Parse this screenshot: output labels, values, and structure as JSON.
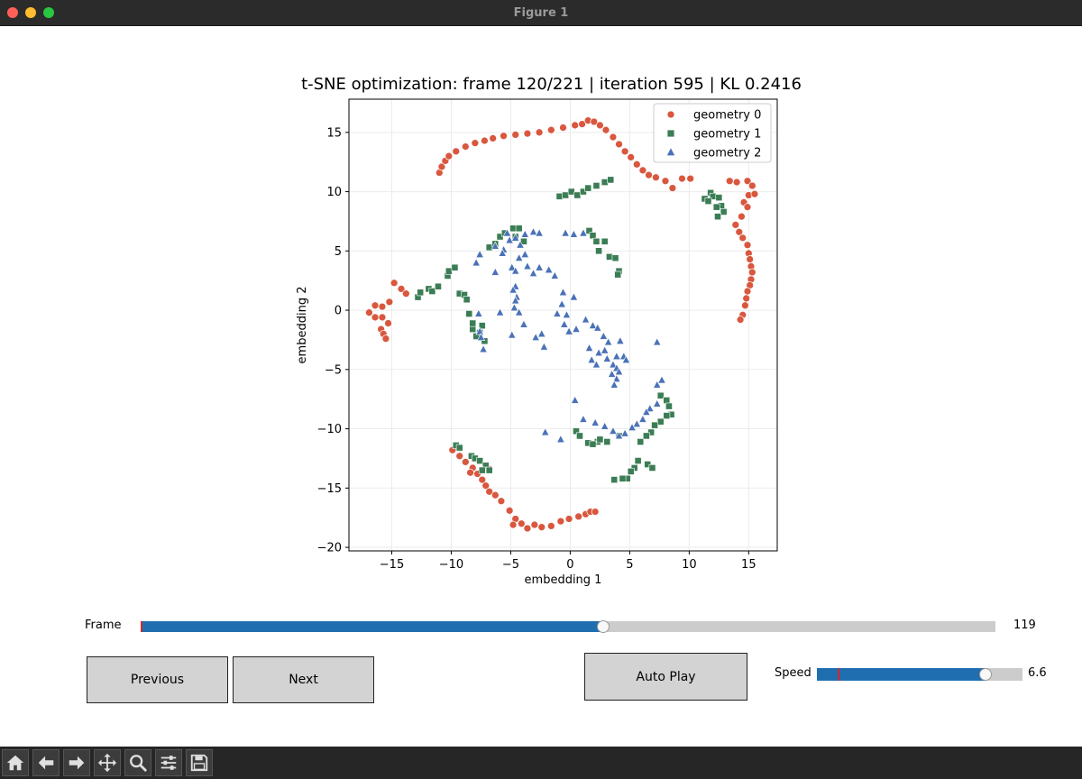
{
  "window": {
    "title": "Figure 1"
  },
  "chart_data": {
    "type": "scatter",
    "title": "t-SNE optimization: frame 120/221 | iteration 595 | KL 0.2416",
    "xlabel": "embedding 1",
    "ylabel": "embedding 2",
    "xlim": [
      -18.6,
      17.4
    ],
    "ylim": [
      -20.3,
      17.8
    ],
    "xticks": [
      -15,
      -10,
      -5,
      0,
      5,
      10,
      15
    ],
    "yticks": [
      -20,
      -15,
      -10,
      -5,
      0,
      5,
      10,
      15
    ],
    "xtick_labels": [
      "−15",
      "−10",
      "−5",
      "0",
      "5",
      "10",
      "15"
    ],
    "ytick_labels": [
      "−20",
      "−15",
      "−10",
      "−5",
      "0",
      "5",
      "10",
      "15"
    ],
    "grid": true,
    "legend_position": "upper right",
    "series": [
      {
        "name": "geometry 0",
        "marker": "circle",
        "color": "#d9573e",
        "points": [
          [
            -11,
            11.6
          ],
          [
            -10.8,
            12.1
          ],
          [
            -10.5,
            12.6
          ],
          [
            -10.2,
            13
          ],
          [
            -9.6,
            13.4
          ],
          [
            -8.8,
            13.8
          ],
          [
            -8,
            14.1
          ],
          [
            -7.2,
            14.3
          ],
          [
            -6.5,
            14.5
          ],
          [
            -5.6,
            14.7
          ],
          [
            -4.6,
            14.8
          ],
          [
            -3.6,
            14.9
          ],
          [
            -2.6,
            15
          ],
          [
            -1.6,
            15.2
          ],
          [
            -0.6,
            15.4
          ],
          [
            0.4,
            15.6
          ],
          [
            1,
            15.7
          ],
          [
            1.5,
            16
          ],
          [
            2,
            15.9
          ],
          [
            2.5,
            15.6
          ],
          [
            3,
            15.2
          ],
          [
            3.6,
            14.6
          ],
          [
            4.1,
            14
          ],
          [
            4.6,
            13.4
          ],
          [
            5.1,
            12.9
          ],
          [
            5.6,
            12.3
          ],
          [
            6.1,
            11.8
          ],
          [
            6.6,
            11.4
          ],
          [
            7.2,
            11.2
          ],
          [
            8,
            10.9
          ],
          [
            8.6,
            10.3
          ],
          [
            9.4,
            11.1
          ],
          [
            10.1,
            11.1
          ],
          [
            13.4,
            10.9
          ],
          [
            14,
            10.8
          ],
          [
            14.9,
            10.9
          ],
          [
            15.3,
            10.5
          ],
          [
            15,
            9.7
          ],
          [
            15.5,
            9.8
          ],
          [
            14.6,
            9.1
          ],
          [
            14.9,
            8.7
          ],
          [
            14.4,
            7.9
          ],
          [
            13.9,
            7.2
          ],
          [
            14.2,
            6.6
          ],
          [
            14.5,
            6.1
          ],
          [
            14.9,
            5.5
          ],
          [
            15,
            4.8
          ],
          [
            15.1,
            4.3
          ],
          [
            15.2,
            3.7
          ],
          [
            15.3,
            3.2
          ],
          [
            15.2,
            2.6
          ],
          [
            15.1,
            2.1
          ],
          [
            14.9,
            1.6
          ],
          [
            14.8,
            1
          ],
          [
            14.7,
            0.4
          ],
          [
            14.5,
            -0.4
          ],
          [
            14.3,
            -0.8
          ],
          [
            -14.8,
            2.3
          ],
          [
            -14.2,
            1.8
          ],
          [
            -13.8,
            1.4
          ],
          [
            -15.2,
            0.7
          ],
          [
            -15.8,
            0.3
          ],
          [
            -16.4,
            0.4
          ],
          [
            -16.9,
            -0.2
          ],
          [
            -16.4,
            -0.6
          ],
          [
            -15.8,
            -0.6
          ],
          [
            -15.3,
            -1.1
          ],
          [
            -15.9,
            -1.6
          ],
          [
            -15.7,
            -2
          ],
          [
            -15.5,
            -2.4
          ],
          [
            -9.9,
            -11.8
          ],
          [
            -9.3,
            -12.3
          ],
          [
            -8.8,
            -12.8
          ],
          [
            -8.2,
            -13.3
          ],
          [
            -7.8,
            -13.8
          ],
          [
            -7.4,
            -14.3
          ],
          [
            -7.1,
            -14.8
          ],
          [
            -6.8,
            -15.3
          ],
          [
            -6.3,
            -15.6
          ],
          [
            -5.8,
            -16.1
          ],
          [
            -5.1,
            -16.9
          ],
          [
            -4.6,
            -17.6
          ],
          [
            -4.1,
            -18
          ],
          [
            -3.6,
            -18.4
          ],
          [
            -3,
            -18.1
          ],
          [
            -2.4,
            -18.3
          ],
          [
            -1.6,
            -18.2
          ],
          [
            -0.8,
            -17.8
          ],
          [
            -0.1,
            -17.6
          ],
          [
            0.7,
            -17.4
          ],
          [
            1.3,
            -17.2
          ],
          [
            1.7,
            -17
          ],
          [
            2.1,
            -17
          ],
          [
            -4.8,
            -18.1
          ],
          [
            -6.8,
            -13.4
          ],
          [
            -8.4,
            -13.7
          ]
        ]
      },
      {
        "name": "geometry 1",
        "marker": "square",
        "color": "#3b7d55",
        "points": [
          [
            -12.8,
            1.1
          ],
          [
            -12.6,
            1.5
          ],
          [
            -11.9,
            1.8
          ],
          [
            -11.6,
            1.6
          ],
          [
            -11.1,
            2
          ],
          [
            -10.3,
            2.9
          ],
          [
            -10.2,
            3.3
          ],
          [
            -9.7,
            3.6
          ],
          [
            -9.3,
            1.4
          ],
          [
            -8.9,
            1.3
          ],
          [
            -8.7,
            0.9
          ],
          [
            -8.5,
            -0.3
          ],
          [
            -8.2,
            -1.6
          ],
          [
            -7.6,
            -1.9
          ],
          [
            -7.4,
            -1.3
          ],
          [
            -7.9,
            -2.2
          ],
          [
            -7.2,
            -2.6
          ],
          [
            -6.8,
            5.3
          ],
          [
            -6.3,
            5.6
          ],
          [
            -5.9,
            6.2
          ],
          [
            -5.5,
            6.5
          ],
          [
            -4.8,
            6.9
          ],
          [
            -4.3,
            6.9
          ],
          [
            -4.6,
            6.2
          ],
          [
            -3.9,
            5.8
          ],
          [
            -0.9,
            9.6
          ],
          [
            -0.4,
            9.7
          ],
          [
            0.1,
            10
          ],
          [
            0.6,
            9.7
          ],
          [
            1.1,
            10
          ],
          [
            1.5,
            10.3
          ],
          [
            2.2,
            10.5
          ],
          [
            2.9,
            10.8
          ],
          [
            3.4,
            11
          ],
          [
            1.6,
            6.7
          ],
          [
            1.9,
            6.3
          ],
          [
            2.2,
            5.8
          ],
          [
            2.9,
            5.8
          ],
          [
            2.4,
            5
          ],
          [
            3.3,
            4.5
          ],
          [
            3.8,
            4.4
          ],
          [
            4.1,
            3.3
          ],
          [
            4,
            3
          ],
          [
            11.8,
            9.9
          ],
          [
            12,
            9.6
          ],
          [
            11.3,
            9.4
          ],
          [
            11.6,
            9.2
          ],
          [
            12.5,
            9.5
          ],
          [
            12.7,
            8.8
          ],
          [
            12.9,
            8.3
          ],
          [
            12.4,
            7.9
          ],
          [
            12.3,
            8.7
          ],
          [
            7.6,
            -7.2
          ],
          [
            8.1,
            -7.6
          ],
          [
            8.3,
            -8.1
          ],
          [
            8.5,
            -8.8
          ],
          [
            8.1,
            -8.9
          ],
          [
            7.6,
            -9.4
          ],
          [
            7.1,
            -9.7
          ],
          [
            6.8,
            -10.3
          ],
          [
            6.4,
            -10.6
          ],
          [
            5.9,
            -11.1
          ],
          [
            5.7,
            -12.7
          ],
          [
            6.5,
            -13
          ],
          [
            6.9,
            -13.3
          ],
          [
            5.4,
            -13.3
          ],
          [
            5.1,
            -13.6
          ],
          [
            4.8,
            -14.2
          ],
          [
            4.4,
            -14.2
          ],
          [
            3.7,
            -14.3
          ],
          [
            -9.6,
            -11.4
          ],
          [
            -9.3,
            -11.6
          ],
          [
            -8.3,
            -12.3
          ],
          [
            -8,
            -12.5
          ],
          [
            -7.6,
            -12.7
          ],
          [
            -7.1,
            -13.1
          ],
          [
            -7.4,
            -13.5
          ],
          [
            -6.8,
            -13.5
          ],
          [
            0.5,
            -10.2
          ],
          [
            0.8,
            -10.6
          ],
          [
            1.5,
            -11.2
          ],
          [
            2.3,
            -11.1
          ],
          [
            1.9,
            -11.3
          ],
          [
            2.5,
            -10.9
          ],
          [
            3.1,
            -11.1
          ],
          [
            4.1,
            -10.6
          ],
          [
            -8.2,
            -1.1
          ]
        ]
      },
      {
        "name": "geometry 2",
        "marker": "triangle",
        "color": "#4a72b8",
        "points": [
          [
            -7.7,
            -0.3
          ],
          [
            -7.6,
            -1.8
          ],
          [
            -7.5,
            -2.3
          ],
          [
            -7.3,
            -3.3
          ],
          [
            -7.9,
            4
          ],
          [
            -7.6,
            4.7
          ],
          [
            -6.3,
            5.4
          ],
          [
            -5.6,
            5.1
          ],
          [
            -5.1,
            5.9
          ],
          [
            -5.7,
            4.8
          ],
          [
            -5.3,
            6.5
          ],
          [
            -4.6,
            6.1
          ],
          [
            -3.8,
            6.4
          ],
          [
            -3.1,
            6.6
          ],
          [
            -2.6,
            6.5
          ],
          [
            -0.4,
            6.5
          ],
          [
            0.3,
            6.4
          ],
          [
            1.1,
            6.5
          ],
          [
            -4.2,
            5.5
          ],
          [
            -3.8,
            4.7
          ],
          [
            -4.3,
            4.4
          ],
          [
            -4.9,
            3.6
          ],
          [
            -4.6,
            3.3
          ],
          [
            -3.6,
            3.7
          ],
          [
            -3.1,
            3.1
          ],
          [
            -2.6,
            3.6
          ],
          [
            -1.8,
            3.4
          ],
          [
            -1.3,
            2.9
          ],
          [
            -4.6,
            2
          ],
          [
            -4.8,
            1.7
          ],
          [
            -4.5,
            1.1
          ],
          [
            -4.6,
            0.8
          ],
          [
            -4.7,
            0.2
          ],
          [
            -4.3,
            -0.2
          ],
          [
            -3.9,
            -1.2
          ],
          [
            -2.4,
            -2
          ],
          [
            -2.9,
            -2.3
          ],
          [
            -2.2,
            -3.1
          ],
          [
            -1.1,
            -0.3
          ],
          [
            -0.7,
            0.5
          ],
          [
            -0.6,
            1.5
          ],
          [
            0.3,
            1.1
          ],
          [
            -0.3,
            -0.4
          ],
          [
            -0.5,
            -1.2
          ],
          [
            -0.1,
            -1.8
          ],
          [
            0.5,
            -1.6
          ],
          [
            1.3,
            -0.8
          ],
          [
            1.9,
            -1.3
          ],
          [
            2.3,
            -1.5
          ],
          [
            2.8,
            -2.2
          ],
          [
            3.2,
            -2.7
          ],
          [
            1.6,
            -3.2
          ],
          [
            1.8,
            -4.2
          ],
          [
            2.2,
            -4.6
          ],
          [
            2.4,
            -3.6
          ],
          [
            2.9,
            -3.4
          ],
          [
            3.1,
            -4.1
          ],
          [
            3.6,
            -4.6
          ],
          [
            3.9,
            -4.9
          ],
          [
            3.5,
            -5.4
          ],
          [
            4.1,
            -5.2
          ],
          [
            3.9,
            -5.8
          ],
          [
            3.7,
            -6.3
          ],
          [
            4.2,
            -2.6
          ],
          [
            3.9,
            -3.9
          ],
          [
            4.5,
            -3.9
          ],
          [
            4.7,
            -4.2
          ],
          [
            7.3,
            -2.7
          ],
          [
            7.7,
            -5.9
          ],
          [
            7.3,
            -6.3
          ],
          [
            7.3,
            -7.9
          ],
          [
            6.7,
            -8.3
          ],
          [
            6.4,
            -8.6
          ],
          [
            6.1,
            -9.2
          ],
          [
            5.6,
            -9.6
          ],
          [
            5.2,
            -9.9
          ],
          [
            4.6,
            -10.4
          ],
          [
            4.1,
            -10.6
          ],
          [
            3.6,
            -10.2
          ],
          [
            2.9,
            -9.8
          ],
          [
            2.1,
            -9.5
          ],
          [
            1.1,
            -9.2
          ],
          [
            0.4,
            -7.6
          ],
          [
            -0.8,
            -10.9
          ],
          [
            -2.1,
            -10.3
          ],
          [
            -4.9,
            -2.1
          ],
          [
            -5.9,
            -0.2
          ],
          [
            -6.3,
            3.2
          ]
        ]
      }
    ]
  },
  "controls": {
    "frame_label": "Frame",
    "frame_value": "119",
    "frame_min": 0,
    "frame_max": 220,
    "frame_current": 119,
    "previous_label": "Previous",
    "next_label": "Next",
    "autoplay_label": "Auto Play",
    "speed_label": "Speed",
    "speed_value": "6.6",
    "speed_fraction": 0.82,
    "speed_initial_fraction": 0.1
  },
  "toolbar": {
    "icons": [
      "home-icon",
      "back-icon",
      "forward-icon",
      "pan-icon",
      "zoom-icon",
      "configure-icon",
      "save-icon"
    ]
  }
}
